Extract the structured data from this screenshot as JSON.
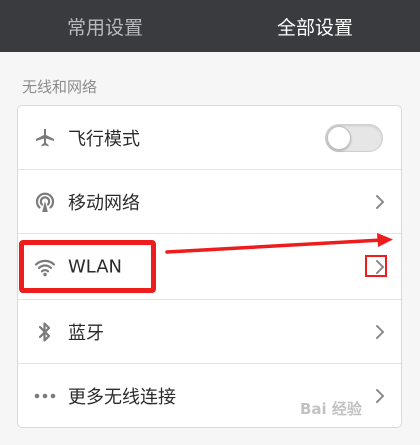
{
  "tabs": [
    {
      "label": "常用设置",
      "active": false
    },
    {
      "label": "全部设置",
      "active": true
    }
  ],
  "section": {
    "title": "无线和网络"
  },
  "rows": [
    {
      "label": "飞行模式",
      "icon": "airplane-icon",
      "control": "toggle",
      "toggle_on": false
    },
    {
      "label": "移动网络",
      "icon": "cellular-signal-icon",
      "control": "chevron"
    },
    {
      "label": "WLAN",
      "icon": "wifi-icon",
      "control": "chevron"
    },
    {
      "label": "蓝牙",
      "icon": "bluetooth-icon",
      "control": "chevron"
    },
    {
      "label": "更多无线连接",
      "icon": "more-dots-icon",
      "control": "chevron"
    }
  ],
  "annotation": {
    "color": "#ee1c1c"
  },
  "watermark": {
    "text": "Bai 经验"
  },
  "colors": {
    "tabbar_bg": "#393b3f",
    "page_bg": "#f6f6f6",
    "icon_gray": "#7a7a7a"
  }
}
